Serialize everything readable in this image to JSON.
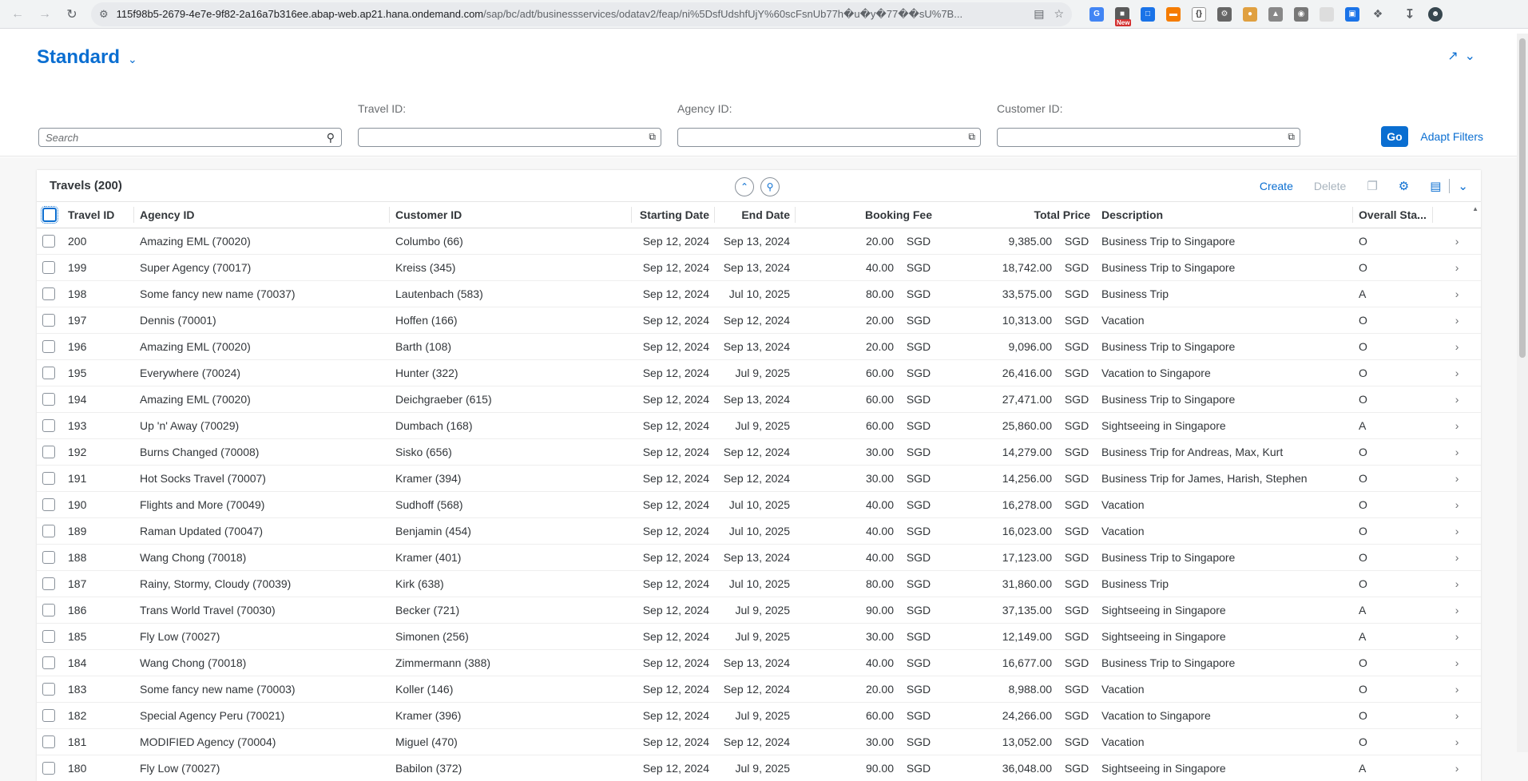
{
  "browser": {
    "url_host": "115f98b5-2679-4e7e-9f82-2a16a7b316ee.abap-web.ap21.hana.ondemand.com",
    "url_path": "/sap/bc/adt/businessservices/odatav2/feap/ni%5DsfUdshfUjY%60scFsnUb77h�u�y�77��sU%7B...",
    "ext_new_badge": "New"
  },
  "header": {
    "variant_title": "Standard"
  },
  "filterbar": {
    "search_placeholder": "Search",
    "travel_id_label": "Travel ID:",
    "agency_id_label": "Agency ID:",
    "customer_id_label": "Customer ID:",
    "go_label": "Go",
    "adapt_label": "Adapt Filters"
  },
  "table": {
    "title": "Travels (200)",
    "create_label": "Create",
    "delete_label": "Delete",
    "columns": [
      "Travel ID",
      "Agency ID",
      "Customer ID",
      "Starting Date",
      "End Date",
      "Booking Fee",
      "Total Price",
      "Description",
      "Overall Sta..."
    ],
    "rows": [
      {
        "id": "200",
        "agency": "Amazing EML (70020)",
        "customer": "Columbo (66)",
        "start": "Sep 12, 2024",
        "end": "Sep 13, 2024",
        "fee": "20.00",
        "fee_cur": "SGD",
        "price": "9,385.00",
        "price_cur": "SGD",
        "desc": "Business Trip to Singapore",
        "status": "O"
      },
      {
        "id": "199",
        "agency": "Super Agency (70017)",
        "customer": "Kreiss (345)",
        "start": "Sep 12, 2024",
        "end": "Sep 13, 2024",
        "fee": "40.00",
        "fee_cur": "SGD",
        "price": "18,742.00",
        "price_cur": "SGD",
        "desc": "Business Trip to Singapore",
        "status": "O"
      },
      {
        "id": "198",
        "agency": "Some fancy new name (70037)",
        "customer": "Lautenbach (583)",
        "start": "Sep 12, 2024",
        "end": "Jul 10, 2025",
        "fee": "80.00",
        "fee_cur": "SGD",
        "price": "33,575.00",
        "price_cur": "SGD",
        "desc": "Business Trip",
        "status": "A"
      },
      {
        "id": "197",
        "agency": "Dennis (70001)",
        "customer": "Hoffen (166)",
        "start": "Sep 12, 2024",
        "end": "Sep 12, 2024",
        "fee": "20.00",
        "fee_cur": "SGD",
        "price": "10,313.00",
        "price_cur": "SGD",
        "desc": "Vacation",
        "status": "O"
      },
      {
        "id": "196",
        "agency": "Amazing EML (70020)",
        "customer": "Barth (108)",
        "start": "Sep 12, 2024",
        "end": "Sep 13, 2024",
        "fee": "20.00",
        "fee_cur": "SGD",
        "price": "9,096.00",
        "price_cur": "SGD",
        "desc": "Business Trip to Singapore",
        "status": "O"
      },
      {
        "id": "195",
        "agency": "Everywhere (70024)",
        "customer": "Hunter (322)",
        "start": "Sep 12, 2024",
        "end": "Jul 9, 2025",
        "fee": "60.00",
        "fee_cur": "SGD",
        "price": "26,416.00",
        "price_cur": "SGD",
        "desc": "Vacation to Singapore",
        "status": "O"
      },
      {
        "id": "194",
        "agency": "Amazing EML (70020)",
        "customer": "Deichgraeber (615)",
        "start": "Sep 12, 2024",
        "end": "Sep 13, 2024",
        "fee": "60.00",
        "fee_cur": "SGD",
        "price": "27,471.00",
        "price_cur": "SGD",
        "desc": "Business Trip to Singapore",
        "status": "O"
      },
      {
        "id": "193",
        "agency": "Up 'n' Away (70029)",
        "customer": "Dumbach (168)",
        "start": "Sep 12, 2024",
        "end": "Jul 9, 2025",
        "fee": "60.00",
        "fee_cur": "SGD",
        "price": "25,860.00",
        "price_cur": "SGD",
        "desc": "Sightseeing in Singapore",
        "status": "A"
      },
      {
        "id": "192",
        "agency": "Burns Changed (70008)",
        "customer": "Sisko (656)",
        "start": "Sep 12, 2024",
        "end": "Sep 12, 2024",
        "fee": "30.00",
        "fee_cur": "SGD",
        "price": "14,279.00",
        "price_cur": "SGD",
        "desc": "Business Trip for Andreas, Max, Kurt",
        "status": "O"
      },
      {
        "id": "191",
        "agency": "Hot Socks Travel (70007)",
        "customer": "Kramer (394)",
        "start": "Sep 12, 2024",
        "end": "Sep 12, 2024",
        "fee": "30.00",
        "fee_cur": "SGD",
        "price": "14,256.00",
        "price_cur": "SGD",
        "desc": "Business Trip for James, Harish, Stephen",
        "status": "O"
      },
      {
        "id": "190",
        "agency": "Flights and More (70049)",
        "customer": "Sudhoff (568)",
        "start": "Sep 12, 2024",
        "end": "Jul 10, 2025",
        "fee": "40.00",
        "fee_cur": "SGD",
        "price": "16,278.00",
        "price_cur": "SGD",
        "desc": "Vacation",
        "status": "O"
      },
      {
        "id": "189",
        "agency": "Raman Updated (70047)",
        "customer": "Benjamin (454)",
        "start": "Sep 12, 2024",
        "end": "Jul 10, 2025",
        "fee": "40.00",
        "fee_cur": "SGD",
        "price": "16,023.00",
        "price_cur": "SGD",
        "desc": "Vacation",
        "status": "O"
      },
      {
        "id": "188",
        "agency": "Wang Chong (70018)",
        "customer": "Kramer (401)",
        "start": "Sep 12, 2024",
        "end": "Sep 13, 2024",
        "fee": "40.00",
        "fee_cur": "SGD",
        "price": "17,123.00",
        "price_cur": "SGD",
        "desc": "Business Trip to Singapore",
        "status": "O"
      },
      {
        "id": "187",
        "agency": "Rainy, Stormy, Cloudy (70039)",
        "customer": "Kirk (638)",
        "start": "Sep 12, 2024",
        "end": "Jul 10, 2025",
        "fee": "80.00",
        "fee_cur": "SGD",
        "price": "31,860.00",
        "price_cur": "SGD",
        "desc": "Business Trip",
        "status": "O"
      },
      {
        "id": "186",
        "agency": "Trans World Travel (70030)",
        "customer": "Becker (721)",
        "start": "Sep 12, 2024",
        "end": "Jul 9, 2025",
        "fee": "90.00",
        "fee_cur": "SGD",
        "price": "37,135.00",
        "price_cur": "SGD",
        "desc": "Sightseeing in Singapore",
        "status": "A"
      },
      {
        "id": "185",
        "agency": "Fly Low (70027)",
        "customer": "Simonen (256)",
        "start": "Sep 12, 2024",
        "end": "Jul 9, 2025",
        "fee": "30.00",
        "fee_cur": "SGD",
        "price": "12,149.00",
        "price_cur": "SGD",
        "desc": "Sightseeing in Singapore",
        "status": "A"
      },
      {
        "id": "184",
        "agency": "Wang Chong (70018)",
        "customer": "Zimmermann (388)",
        "start": "Sep 12, 2024",
        "end": "Sep 13, 2024",
        "fee": "40.00",
        "fee_cur": "SGD",
        "price": "16,677.00",
        "price_cur": "SGD",
        "desc": "Business Trip to Singapore",
        "status": "O"
      },
      {
        "id": "183",
        "agency": "Some fancy new name (70003)",
        "customer": "Koller (146)",
        "start": "Sep 12, 2024",
        "end": "Sep 12, 2024",
        "fee": "20.00",
        "fee_cur": "SGD",
        "price": "8,988.00",
        "price_cur": "SGD",
        "desc": "Vacation",
        "status": "O"
      },
      {
        "id": "182",
        "agency": "Special Agency Peru (70021)",
        "customer": "Kramer (396)",
        "start": "Sep 12, 2024",
        "end": "Jul 9, 2025",
        "fee": "60.00",
        "fee_cur": "SGD",
        "price": "24,266.00",
        "price_cur": "SGD",
        "desc": "Vacation to Singapore",
        "status": "O"
      },
      {
        "id": "181",
        "agency": "MODIFIED Agency (70004)",
        "customer": "Miguel (470)",
        "start": "Sep 12, 2024",
        "end": "Sep 12, 2024",
        "fee": "30.00",
        "fee_cur": "SGD",
        "price": "13,052.00",
        "price_cur": "SGD",
        "desc": "Vacation",
        "status": "O"
      },
      {
        "id": "180",
        "agency": "Fly Low (70027)",
        "customer": "Babilon (372)",
        "start": "Sep 12, 2024",
        "end": "Jul 9, 2025",
        "fee": "90.00",
        "fee_cur": "SGD",
        "price": "36,048.00",
        "price_cur": "SGD",
        "desc": "Sightseeing in Singapore",
        "status": "A"
      }
    ]
  },
  "colors": {
    "accent": "#0a6ed1",
    "text": "#32363a",
    "muted": "#6a6d70"
  },
  "icons": [
    "back-icon",
    "forward-icon",
    "reload-icon",
    "site-info-icon",
    "translate-icon",
    "star-icon",
    "search-icon",
    "value-help-icon",
    "collapse-icon",
    "pin-icon",
    "copy-icon",
    "settings-icon",
    "export-icon",
    "chevron-down-icon",
    "chevron-right-icon",
    "share-icon"
  ]
}
